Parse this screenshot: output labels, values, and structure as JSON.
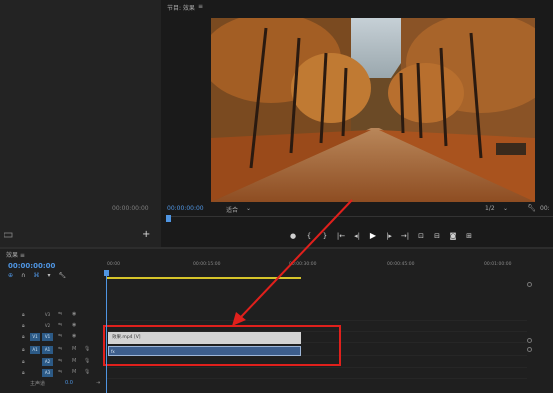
{
  "source": {
    "timecode": "00:00:00:00",
    "add_label": "+"
  },
  "program": {
    "title": "节目: 效果",
    "menu": "≡",
    "timecode": "00:00:00:00",
    "fit": "适合",
    "resolution": "1/2",
    "end": "00:"
  },
  "transport": {
    "buttons": [
      "●",
      "{",
      "}",
      "|←",
      "◂|",
      "▶",
      "|▸",
      "→|",
      "⊡",
      "⊟",
      "◙",
      "⊞"
    ]
  },
  "timeline": {
    "title": "效果 ≡",
    "timecode": "00:00:00:00",
    "ruler": [
      "00:00",
      "00:00:15:00",
      "00:00:30:00",
      "00:00:45:00",
      "00:01:00:00"
    ],
    "tracks": [
      {
        "src": "",
        "name": "V3",
        "on": false
      },
      {
        "src": "",
        "name": "V2",
        "on": false
      },
      {
        "src": "V1",
        "name": "V1",
        "on": true
      },
      {
        "src": "A1",
        "name": "A1",
        "on": true
      },
      {
        "src": "",
        "name": "A2",
        "on": true
      },
      {
        "src": "",
        "name": "A3",
        "on": true
      }
    ],
    "video_clip_label": "效果.mp4 [V]",
    "audio_clip_label": "fx",
    "master_label": "主声道",
    "master_value": "0.0"
  },
  "colors": {
    "accent": "#4f95e2",
    "highlight": "#e0201c",
    "work_area": "#d6c42a"
  }
}
